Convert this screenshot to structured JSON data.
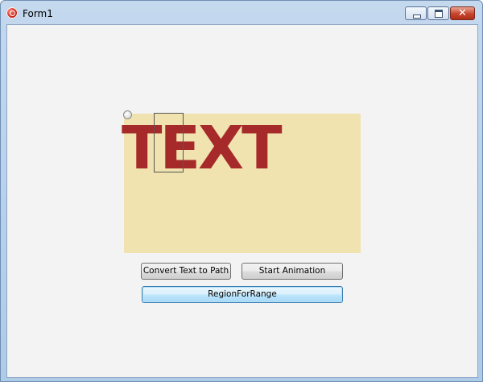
{
  "window": {
    "title": "Form1",
    "icon": "app-icon",
    "controls": {
      "minimize_icon": "minimize-icon",
      "maximize_icon": "maximize-icon",
      "close_icon": "close-icon",
      "close_glyph": "✕"
    }
  },
  "canvas": {
    "text": "TEXT",
    "text_color": "#a72a2a",
    "background": "#f0e3b0"
  },
  "buttons": {
    "convert_label": "Convert Text to Path",
    "start_label": "Start Animation",
    "region_label": "RegionForRange"
  }
}
